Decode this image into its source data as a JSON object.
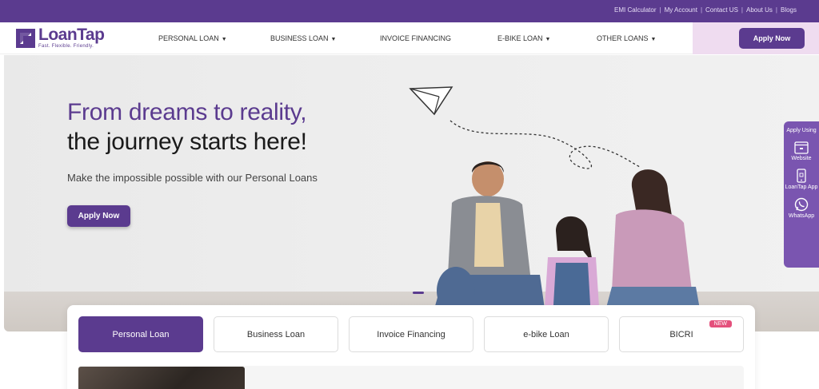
{
  "topbar": {
    "links": [
      "EMI Calculator",
      "My Account",
      "Contact US",
      "About Us",
      "Blogs"
    ]
  },
  "brand": {
    "name": "LoanTap",
    "tagline": "Fast. Flexible. Friendly."
  },
  "nav": {
    "items": [
      {
        "label": "PERSONAL LOAN",
        "dropdown": true
      },
      {
        "label": "BUSINESS LOAN",
        "dropdown": true
      },
      {
        "label": "INVOICE FINANCING",
        "dropdown": false
      },
      {
        "label": "E-BIKE LOAN",
        "dropdown": true
      },
      {
        "label": "OTHER LOANS",
        "dropdown": true
      }
    ],
    "apply_label": "Apply Now"
  },
  "hero": {
    "headline_1": "From dreams to reality,",
    "headline_2": "the journey starts here!",
    "subtitle": "Make the impossible possible with our Personal Loans",
    "cta_label": "Apply Now"
  },
  "side_panel": {
    "heading": "Apply Using",
    "items": [
      {
        "label": "Website",
        "icon": "browser-icon"
      },
      {
        "label": "LoanTap App",
        "icon": "phone-icon"
      },
      {
        "label": "WhatsApp",
        "icon": "whatsapp-icon"
      }
    ]
  },
  "loan_tabs": {
    "tabs": [
      {
        "label": "Personal Loan",
        "active": true
      },
      {
        "label": "Business Loan",
        "active": false
      },
      {
        "label": "Invoice Financing",
        "active": false
      },
      {
        "label": "e-bike Loan",
        "active": false
      },
      {
        "label": "BICRI",
        "active": false,
        "badge": "NEW"
      }
    ]
  },
  "colors": {
    "brand_purple": "#5b3b8f",
    "badge_pink": "#e4507c",
    "apply_bg": "#efdcf0"
  }
}
